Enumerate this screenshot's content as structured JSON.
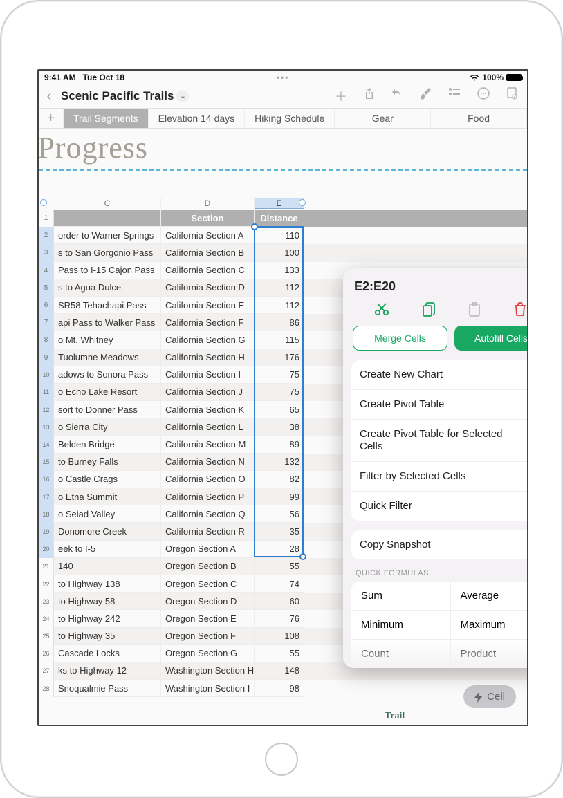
{
  "status": {
    "time": "9:41 AM",
    "date": "Tue Oct 18",
    "battery": "100%"
  },
  "document": {
    "title": "Scenic Pacific Trails"
  },
  "canvas_title": "il Progress",
  "tabs": [
    {
      "label": "Trail Segments",
      "active": true
    },
    {
      "label": "Elevation 14 days",
      "active": false
    },
    {
      "label": "Hiking Schedule",
      "active": false
    },
    {
      "label": "Gear",
      "active": false
    },
    {
      "label": "Food",
      "active": false
    }
  ],
  "columns": {
    "c": "C",
    "d": "D",
    "e": "E"
  },
  "headers": {
    "section": "Section",
    "distance": "Distance"
  },
  "rows": [
    {
      "n": 2,
      "b": "order to Warner Springs",
      "c": "California Section A",
      "d": 110
    },
    {
      "n": 3,
      "b": "s to San Gorgonio Pass",
      "c": "California Section B",
      "d": 100
    },
    {
      "n": 4,
      "b": "Pass to I-15 Cajon Pass",
      "c": "California Section C",
      "d": 133
    },
    {
      "n": 5,
      "b": "s to Agua Dulce",
      "c": "California Section D",
      "d": 112
    },
    {
      "n": 6,
      "b": "SR58 Tehachapi Pass",
      "c": "California Section E",
      "d": 112
    },
    {
      "n": 7,
      "b": "api Pass to Walker Pass",
      "c": "California Section F",
      "d": 86
    },
    {
      "n": 8,
      "b": "o Mt. Whitney",
      "c": "California Section G",
      "d": 115
    },
    {
      "n": 9,
      "b": "Tuolumne Meadows",
      "c": "California Section H",
      "d": 176
    },
    {
      "n": 10,
      "b": "adows to Sonora Pass",
      "c": "California Section I",
      "d": 75
    },
    {
      "n": 11,
      "b": "o Echo Lake Resort",
      "c": "California Section J",
      "d": 75
    },
    {
      "n": 12,
      "b": "sort to Donner Pass",
      "c": "California Section K",
      "d": 65
    },
    {
      "n": 13,
      "b": "o Sierra City",
      "c": "California Section L",
      "d": 38
    },
    {
      "n": 14,
      "b": "Belden Bridge",
      "c": "California Section M",
      "d": 89
    },
    {
      "n": 15,
      "b": "to Burney Falls",
      "c": "California Section N",
      "d": 132
    },
    {
      "n": 16,
      "b": "o Castle Crags",
      "c": "California Section O",
      "d": 82
    },
    {
      "n": 17,
      "b": "o Etna Summit",
      "c": "California Section P",
      "d": 99
    },
    {
      "n": 18,
      "b": "o Seiad Valley",
      "c": "California Section Q",
      "d": 56
    },
    {
      "n": 19,
      "b": "Donomore Creek",
      "c": "California Section R",
      "d": 35
    },
    {
      "n": 20,
      "b": "eek to I-5",
      "c": "Oregon Section A",
      "d": 28
    },
    {
      "n": 21,
      "b": "140",
      "c": "Oregon Section B",
      "d": 55
    },
    {
      "n": 22,
      "b": "to Highway 138",
      "c": "Oregon Section C",
      "d": 74
    },
    {
      "n": 23,
      "b": "to Highway 58",
      "c": "Oregon Section D",
      "d": 60
    },
    {
      "n": 24,
      "b": "to Highway 242",
      "c": "Oregon Section E",
      "d": 76
    },
    {
      "n": 25,
      "b": "to Highway 35",
      "c": "Oregon Section F",
      "d": 108
    },
    {
      "n": 26,
      "b": "Cascade Locks",
      "c": "Oregon Section G",
      "d": 55
    },
    {
      "n": 27,
      "b": "ks to Highway 12",
      "c": "Washington Section H",
      "d": 148
    },
    {
      "n": 28,
      "b": "Snoqualmie Pass",
      "c": "Washington Section I",
      "d": 98
    }
  ],
  "selection_range": "E2:E20",
  "popover": {
    "merge": "Merge Cells",
    "autofill": "Autofill Cells",
    "actions": [
      "Create New Chart",
      "Create Pivot Table",
      "Create Pivot Table for Selected Cells",
      "Filter by Selected Cells",
      "Quick Filter"
    ],
    "copy_snapshot": "Copy Snapshot",
    "formulas_label": "QUICK FORMULAS",
    "formulas": [
      "Sum",
      "Average",
      "Minimum",
      "Maximum",
      "Count",
      "Product"
    ]
  },
  "cell_pill": "Cell",
  "trail_label": "Trail"
}
